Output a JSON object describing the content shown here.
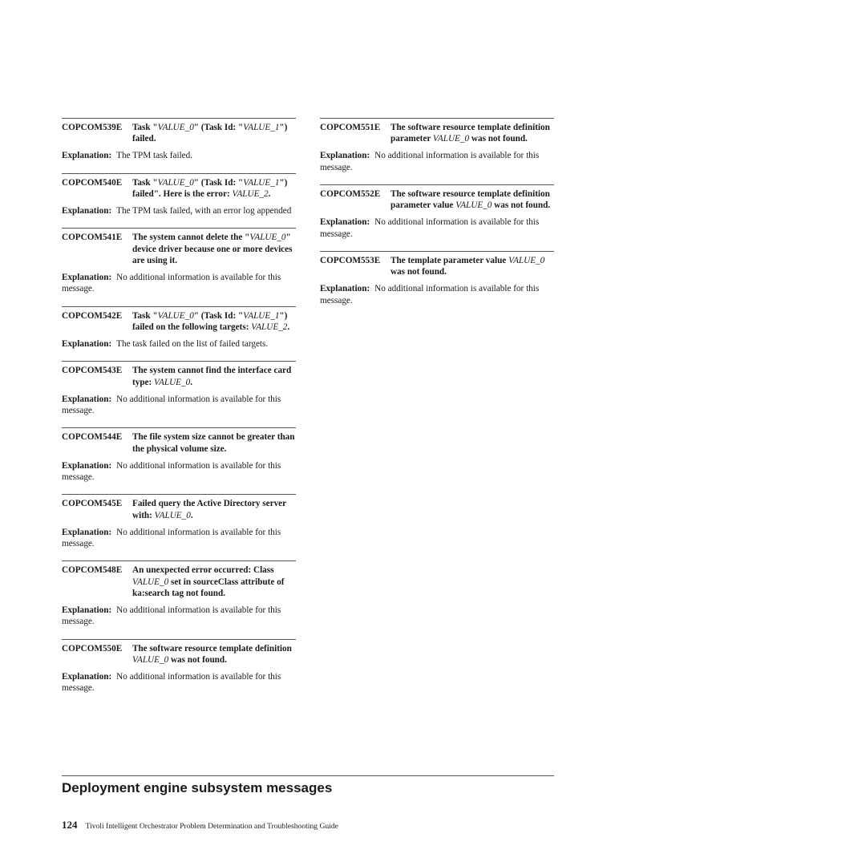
{
  "document": {
    "columns": {
      "left": [
        {
          "id": "COPCOM539E",
          "title_parts": [
            {
              "t": "Task \"",
              "i": false
            },
            {
              "t": "VALUE_0",
              "i": true
            },
            {
              "t": "\" (Task Id: \"",
              "i": false
            },
            {
              "t": "VALUE_1",
              "i": true
            },
            {
              "t": "\") failed.",
              "i": false
            }
          ],
          "explanation_label": "Explanation:",
          "explanation": "The TPM task failed."
        },
        {
          "id": "COPCOM540E",
          "title_parts": [
            {
              "t": "Task \"",
              "i": false
            },
            {
              "t": "VALUE_0",
              "i": true
            },
            {
              "t": "\" (Task Id: \"",
              "i": false
            },
            {
              "t": "VALUE_1",
              "i": true
            },
            {
              "t": "\") failed\". Here is the error: ",
              "i": false
            },
            {
              "t": "VALUE_2",
              "i": true
            },
            {
              "t": ".",
              "i": false
            }
          ],
          "explanation_label": "Explanation:",
          "explanation": "The TPM task failed, with an error log appended"
        },
        {
          "id": "COPCOM541E",
          "title_parts": [
            {
              "t": "The system cannot delete the \"",
              "i": false
            },
            {
              "t": "VALUE_0",
              "i": true
            },
            {
              "t": "\" device driver because one or more devices are using it.",
              "i": false
            }
          ],
          "explanation_label": "Explanation:",
          "explanation": "No additional information is available for this message."
        },
        {
          "id": "COPCOM542E",
          "title_parts": [
            {
              "t": "Task \"",
              "i": false
            },
            {
              "t": "VALUE_0",
              "i": true
            },
            {
              "t": "\" (Task Id: \"",
              "i": false
            },
            {
              "t": "VALUE_1",
              "i": true
            },
            {
              "t": "\") failed on the following targets: ",
              "i": false
            },
            {
              "t": "VALUE_2",
              "i": true
            },
            {
              "t": ".",
              "i": false
            }
          ],
          "explanation_label": "Explanation:",
          "explanation": "The task failed on the list of failed targets."
        },
        {
          "id": "COPCOM543E",
          "title_parts": [
            {
              "t": "The system cannot find the interface card type: ",
              "i": false
            },
            {
              "t": "VALUE_0",
              "i": true
            },
            {
              "t": ".",
              "i": false
            }
          ],
          "explanation_label": "Explanation:",
          "explanation": "No additional information is available for this message."
        },
        {
          "id": "COPCOM544E",
          "title_parts": [
            {
              "t": "The file system size cannot be greater than the physical volume size.",
              "i": false
            }
          ],
          "explanation_label": "Explanation:",
          "explanation": "No additional information is available for this message."
        },
        {
          "id": "COPCOM545E",
          "title_parts": [
            {
              "t": "Failed query the Active Directory server with: ",
              "i": false
            },
            {
              "t": "VALUE_0",
              "i": true
            },
            {
              "t": ".",
              "i": false
            }
          ],
          "explanation_label": "Explanation:",
          "explanation": "No additional information is available for this message."
        },
        {
          "id": "COPCOM548E",
          "title_parts": [
            {
              "t": "An unexpected error occurred: Class ",
              "i": false
            },
            {
              "t": "VALUE_0",
              "i": true
            },
            {
              "t": " set in sourceClass attribute of ka:search tag not found.",
              "i": false
            }
          ],
          "explanation_label": "Explanation:",
          "explanation": "No additional information is available for this message."
        },
        {
          "id": "COPCOM550E",
          "title_parts": [
            {
              "t": "The software resource template definition ",
              "i": false
            },
            {
              "t": "VALUE_0",
              "i": true
            },
            {
              "t": " was not found.",
              "i": false
            }
          ],
          "explanation_label": "Explanation:",
          "explanation": "No additional information is available for this message."
        }
      ],
      "right": [
        {
          "id": "COPCOM551E",
          "title_parts": [
            {
              "t": "The software resource template definition parameter ",
              "i": false
            },
            {
              "t": "VALUE_0",
              "i": true
            },
            {
              "t": " was not found.",
              "i": false
            }
          ],
          "explanation_label": "Explanation:",
          "explanation": "No additional information is available for this message."
        },
        {
          "id": "COPCOM552E",
          "title_parts": [
            {
              "t": "The software resource template definition parameter value ",
              "i": false
            },
            {
              "t": "VALUE_0",
              "i": true
            },
            {
              "t": " was not found.",
              "i": false
            }
          ],
          "explanation_label": "Explanation:",
          "explanation": "No additional information is available for this message."
        },
        {
          "id": "COPCOM553E",
          "title_parts": [
            {
              "t": "The template parameter value ",
              "i": false
            },
            {
              "t": "VALUE_0",
              "i": true
            },
            {
              "t": " was not found.",
              "i": false
            }
          ],
          "explanation_label": "Explanation:",
          "explanation": "No additional information is available for this message."
        }
      ]
    },
    "section_heading": "Deployment engine subsystem messages",
    "footer": {
      "page_number": "124",
      "title": "Tivoli Intelligent Orchestrator Problem Determination and Troubleshooting Guide"
    }
  }
}
